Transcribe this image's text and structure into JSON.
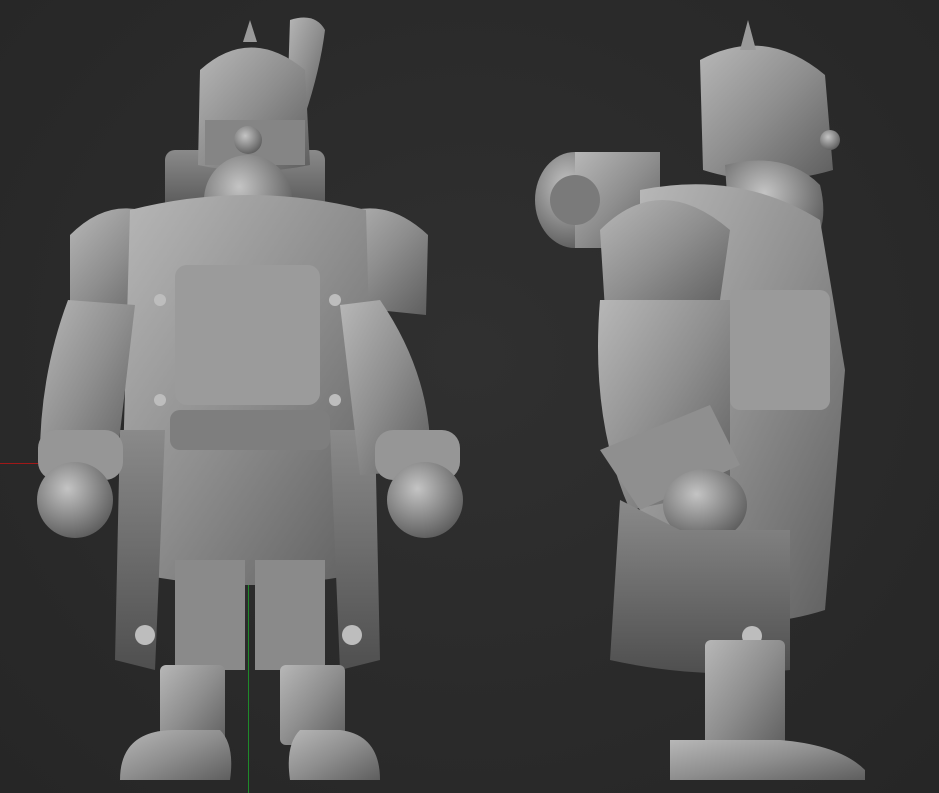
{
  "viewport": {
    "background": "#2b2b2b",
    "model_color": "#8f8f8f",
    "axis_x_color": "#a01818",
    "axis_y_color": "#1f8a2a"
  },
  "views": [
    {
      "name": "front-view"
    },
    {
      "name": "side-view"
    }
  ]
}
